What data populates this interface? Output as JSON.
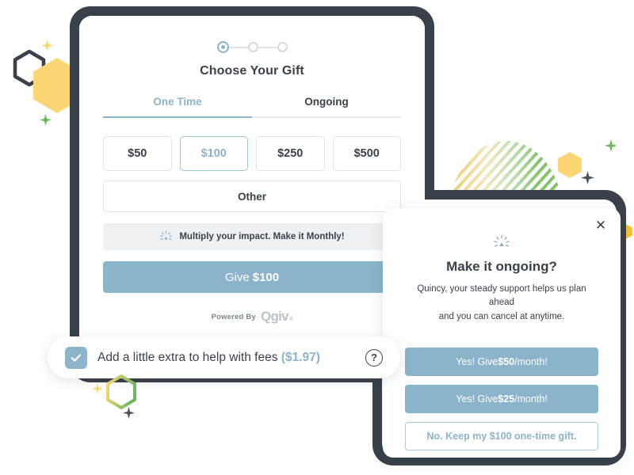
{
  "form": {
    "steps": [
      {
        "name": "step-1",
        "state": "active"
      },
      {
        "name": "step-2",
        "state": "inactive"
      },
      {
        "name": "step-3",
        "state": "inactive"
      }
    ],
    "title": "Choose Your Gift",
    "tabs": [
      {
        "label": "One Time",
        "active": true
      },
      {
        "label": "Ongoing",
        "active": false
      }
    ],
    "amounts": [
      {
        "label": "$50",
        "selected": false
      },
      {
        "label": "$100",
        "selected": true
      },
      {
        "label": "$250",
        "selected": false
      },
      {
        "label": "$500",
        "selected": false
      }
    ],
    "other_label": "Other",
    "upsell": {
      "icon": "sparkle-icon",
      "text": "Multiply your impact. Make it Monthly!"
    },
    "give_button": {
      "label": "Give",
      "amount": "$100"
    },
    "powered_by": {
      "prefix": "Powered By",
      "brand": "Qgiv",
      "mark": "®"
    }
  },
  "fee_bar": {
    "checkbox_state": "checked",
    "label": "Add a little extra to help with fees",
    "amount": "($1.97)",
    "help_icon_label": "?"
  },
  "modal": {
    "close_label": "✕",
    "icon": "sparkle-icon",
    "title": "Make it ongoing?",
    "subtitle_line1": "Quincy, your steady support helps us plan ahead",
    "subtitle_line2": "and you can cancel at anytime.",
    "buttons": [
      {
        "prefix": "Yes! Give ",
        "amount": "$50",
        "suffix": "/month!",
        "style": "primary"
      },
      {
        "prefix": "Yes! Give ",
        "amount": "$25",
        "suffix": "/month!",
        "style": "primary"
      },
      {
        "prefix": "No. Keep my $100 one-time gift.",
        "amount": "",
        "suffix": "",
        "style": "ghost"
      }
    ]
  },
  "colors": {
    "accent_blue": "#8bb4cb",
    "dark_frame": "#39414b",
    "yellow": "#fcd674",
    "green": "#6fb85f",
    "light_gray": "#eef1f3"
  }
}
